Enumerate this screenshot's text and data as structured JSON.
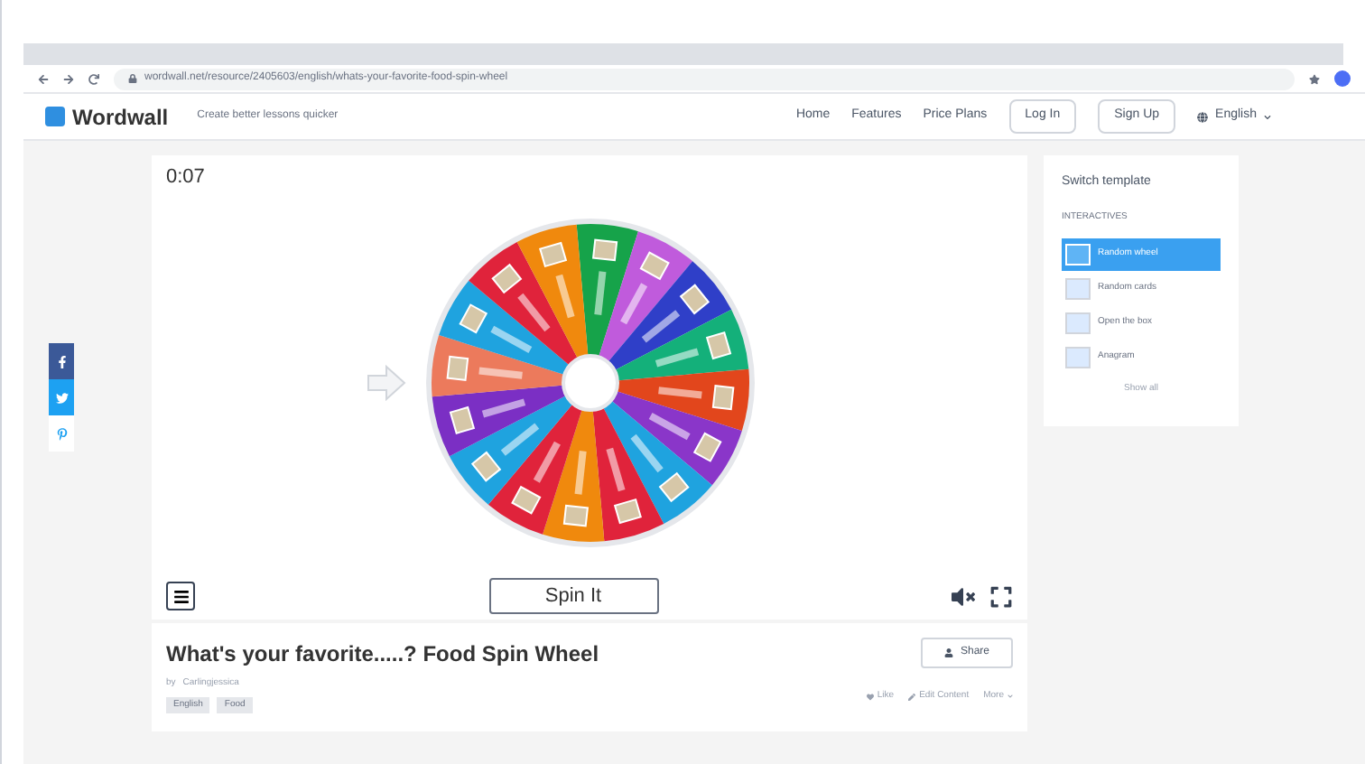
{
  "browser": {
    "address": "wordwall.net/resource/2405603/english/whats-your-favorite-food-spin-wheel"
  },
  "header": {
    "logo": "Wordwall",
    "tagline": "Create better lessons quicker",
    "nav": [
      "Home",
      "Features",
      "Price Plans"
    ],
    "buttons": [
      "Log In",
      "Sign Up"
    ],
    "language": "English"
  },
  "game": {
    "timer": "0:07",
    "spin_button": "Spin It"
  },
  "wheel": {
    "segments": [
      {
        "color": "#16a34a"
      },
      {
        "color": "#c05bdc"
      },
      {
        "color": "#2f3fc8"
      },
      {
        "color": "#14b07a"
      },
      {
        "color": "#e2461c"
      },
      {
        "color": "#8a36c9"
      },
      {
        "color": "#1fa3df"
      },
      {
        "color": "#e0233b"
      },
      {
        "color": "#f0890d"
      },
      {
        "color": "#e0233b"
      },
      {
        "color": "#1fa3df"
      },
      {
        "color": "#7b2fc4"
      },
      {
        "color": "#ec7a5c"
      },
      {
        "color": "#1fa3df"
      },
      {
        "color": "#e0233b"
      },
      {
        "color": "#f0890d"
      }
    ]
  },
  "activity": {
    "title": "What's your favorite.....? Food Spin Wheel",
    "author_prefix": "by",
    "author": "Carlingjessica",
    "tags": [
      "English",
      "Food"
    ],
    "share": "Share",
    "actions": [
      "Like",
      "Edit Content",
      "More"
    ]
  },
  "templates": {
    "title": "Switch template",
    "section": "INTERACTIVES",
    "items": [
      {
        "label": "Random wheel",
        "selected": true
      },
      {
        "label": "Random cards",
        "selected": false
      },
      {
        "label": "Open the box",
        "selected": false
      },
      {
        "label": "Anagram",
        "selected": false
      }
    ],
    "show_all": "Show all"
  }
}
